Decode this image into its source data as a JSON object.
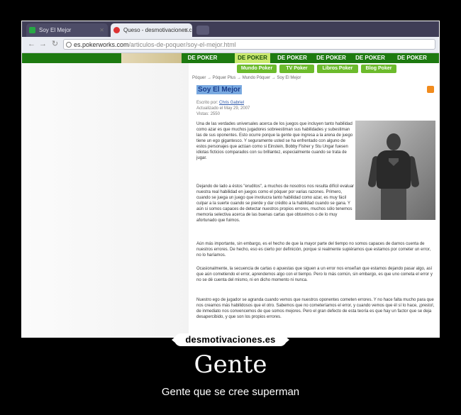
{
  "browser": {
    "tabs": [
      {
        "label": "Soy El Mejor",
        "active": true
      },
      {
        "label": "Queso - desmotivaciones.c",
        "active": false
      }
    ],
    "url_domain": "es.pokerworks.com",
    "url_path": "/articulos-de-poquer/soy-el-mejor.html"
  },
  "site": {
    "nav": [
      "DE POKER",
      "DE POKER",
      "DE POKER",
      "DE POKER",
      "DE POKER",
      "DE POKER"
    ],
    "active_nav_index": 1,
    "subnav": [
      "Mundo Poker",
      "TV Poker",
      "Libros Poker",
      "Blog Poker"
    ],
    "breadcrumb": "Póquer → Póquer Plus → Mundo Póquer → Soy El Mejor"
  },
  "article": {
    "title": "Soy El Mejor",
    "author_prefix": "Escrito por:",
    "author": "Chris Gabriel",
    "updated": "Actualizado el May 29, 2007",
    "views": "Vistas: 2550",
    "paragraphs": [
      "Una de las verdades universales acerca de los juegos que incluyen tanto habilidad como azar es que muchos jugadores sobreestiman sus habilidades y subestiman las de sus oponentes. Esto ocurre porque la gente que ingresa a la arena de juego tiene un ego gigantesco. Y seguramente usted se ha enfrentado con alguno de estos personajes que actúan como si Einstein, Bobby Fisher y Stu Ungar fuesen idiotas ficticios comparados con su brillantez, especialmente cuando se trata de jugar.",
      "Dejando de lado a éstos \"eruditos\", a muchos de nosotros nos resulta difícil evaluar nuestra real habilidad en juegos como el póquer por varias razones. Primero, cuando se juega un juego que involucra tanto habilidad como azar, es muy fácil culpar a la suerte cuando se pierde y dar crédito a la habilidad cuando se gana. Y aún si somos capaces de detectar nuestros propios errores, muchos sólo tenemos memoria selectiva acerca de las buenas cartas que obtuvimos o de lo muy afortunado que fuimos.",
      "Aún más importante, sin embargo, es el hecho de que la mayor parte del tiempo no somos capaces de darnos cuenta de nuestros errores. De hecho, eso es cierto por definición, porque si realmente supiéramos que estamos por cometer un error, no lo haríamos.",
      "Ocasionalmente, la secuencia de cartas o apuestas que siguen a un error nos enseñan que estamos dejando pasar algo, así que aún cometiendo el error, aprendemos algo con el tiempo. Pero lo más común, sin embargo, es que uno cometa el error y no se dé cuenta del mismo, ni en dicho momento ni nunca.",
      "Nuestro ego de jugador se agranda cuando vemos que nuestros oponentes cometen errores. Y no hace falta mucho para que nos creamos más habilidosos que el otro. Sabemos que no cometeríamos el error, y cuando vemos que él sí lo hace, ¡presto!, de inmediato nos convencemos de que somos mejores. Pero el gran defecto de esta teoría es que hay un factor que se deja desapercibido, y que son los propios errores."
    ]
  },
  "meme": {
    "brand": "desmotivaciones.es",
    "title": "Gente",
    "subtitle": "Gente que se cree superman"
  }
}
